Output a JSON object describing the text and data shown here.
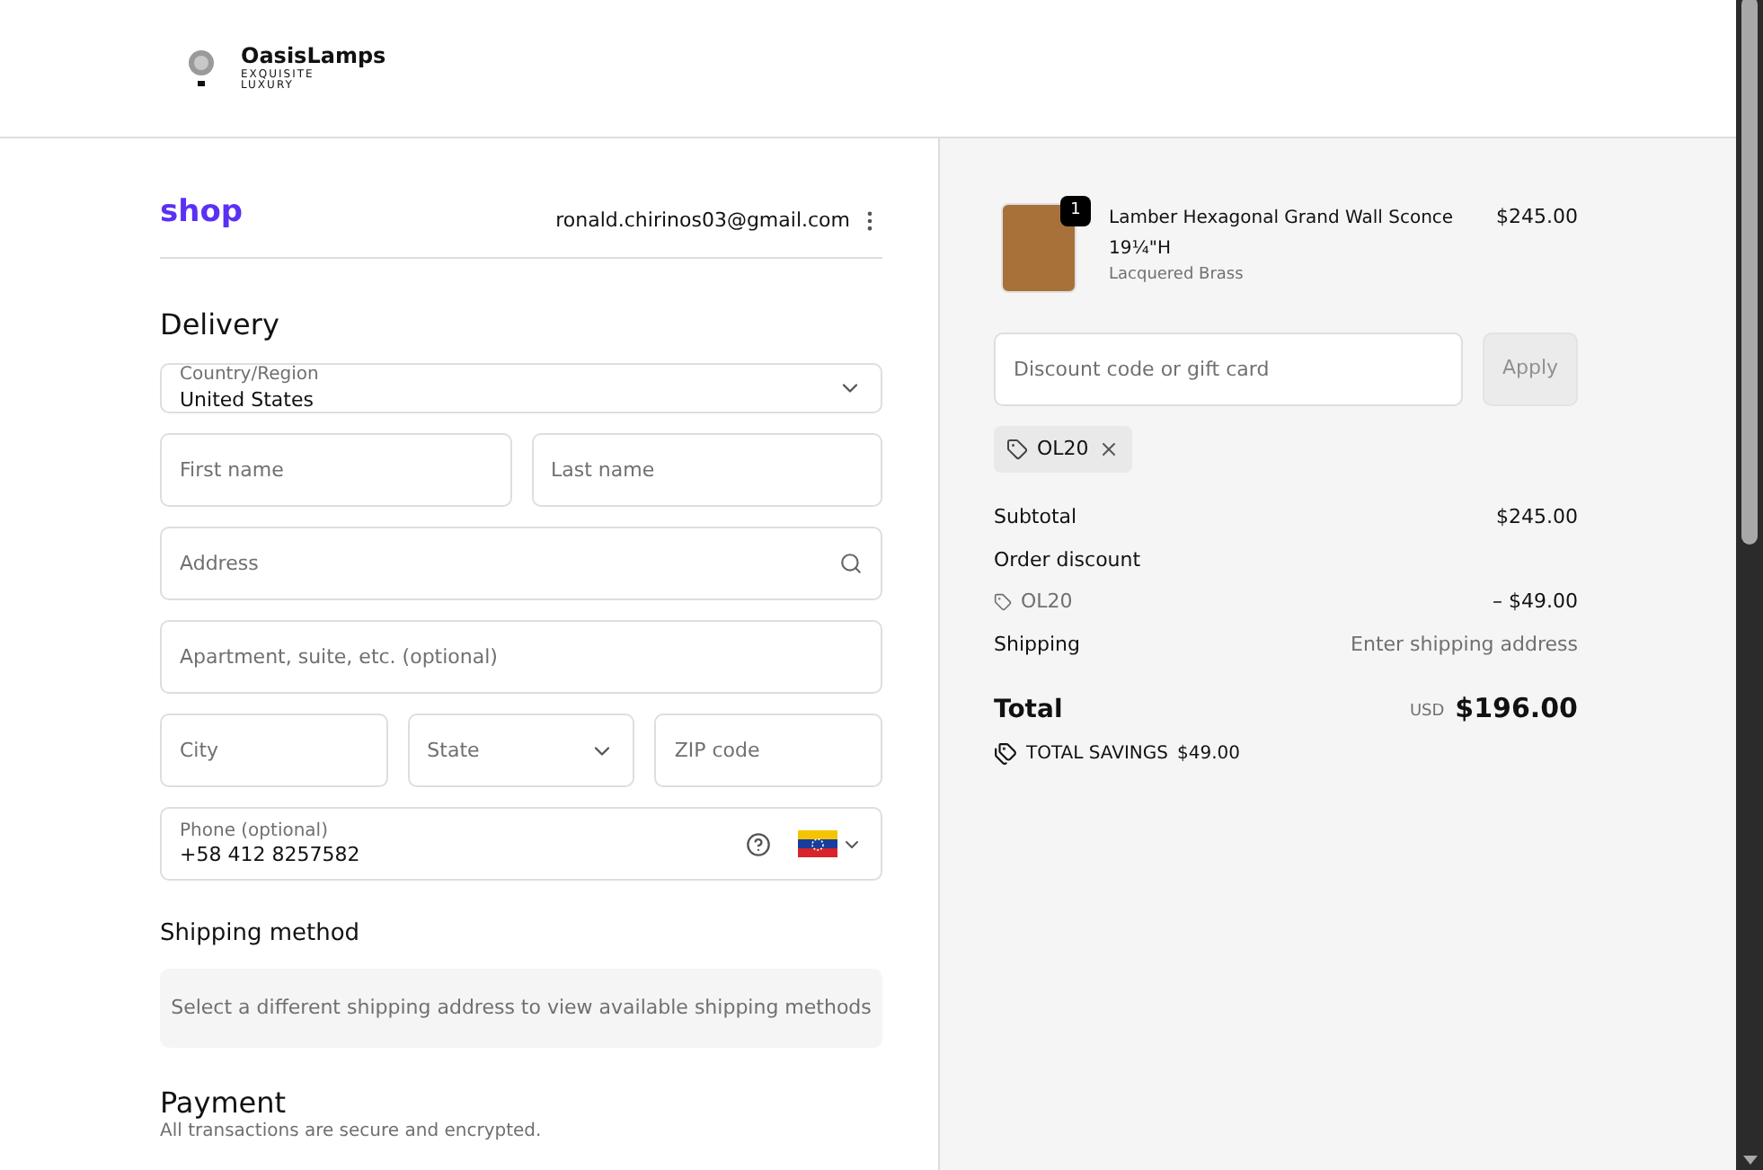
{
  "header": {
    "brand": "OasisLamps",
    "tagline": "EXQUISITE LUXURY"
  },
  "account": {
    "shop_label": "shop",
    "email": "ronald.chirinos03@gmail.com"
  },
  "delivery": {
    "title": "Delivery",
    "fields": [
      {
        "kind": "select",
        "label": "Country/Region",
        "value": "United States"
      },
      {
        "kind": "row",
        "items": [
          {
            "kind": "input",
            "placeholder": "First name"
          },
          {
            "kind": "input",
            "placeholder": "Last name"
          }
        ]
      },
      {
        "kind": "search",
        "placeholder": "Address"
      },
      {
        "kind": "input",
        "placeholder": "Apartment, suite, etc. (optional)"
      },
      {
        "kind": "row",
        "items": [
          {
            "kind": "input",
            "placeholder": "City"
          },
          {
            "kind": "select",
            "placeholder": "State"
          },
          {
            "kind": "input",
            "placeholder": "ZIP code"
          }
        ]
      },
      {
        "kind": "phone",
        "label": "Phone (optional)",
        "value": "+58 412 8257582"
      }
    ]
  },
  "shipping_method": {
    "title": "Shipping method",
    "message": "Select a different shipping address to view available shipping methods"
  },
  "payment": {
    "title": "Payment",
    "subtitle": "All transactions are secure and encrypted."
  },
  "order": {
    "items": [
      {
        "quantity": "1",
        "name": "Lamber Hexagonal Grand Wall Sconce 19¼\"H",
        "variant": "Lacquered Brass",
        "price": "$245.00"
      }
    ],
    "discount": {
      "placeholder": "Discount code or gift card",
      "button": "Apply",
      "disabled": true
    },
    "applied_codes": [
      "OL20"
    ],
    "summary": [
      {
        "kind": "line",
        "label": "Subtotal",
        "value": "$245.00"
      },
      {
        "kind": "heading",
        "label": "Order discount"
      },
      {
        "kind": "code",
        "label": "OL20",
        "value": "– $49.00"
      },
      {
        "kind": "muted",
        "label": "Shipping",
        "value": "Enter shipping address"
      }
    ],
    "total": {
      "label": "Total",
      "currency": "USD",
      "value": "$196.00"
    },
    "savings": {
      "label": "TOTAL SAVINGS",
      "value": "$49.00"
    }
  }
}
